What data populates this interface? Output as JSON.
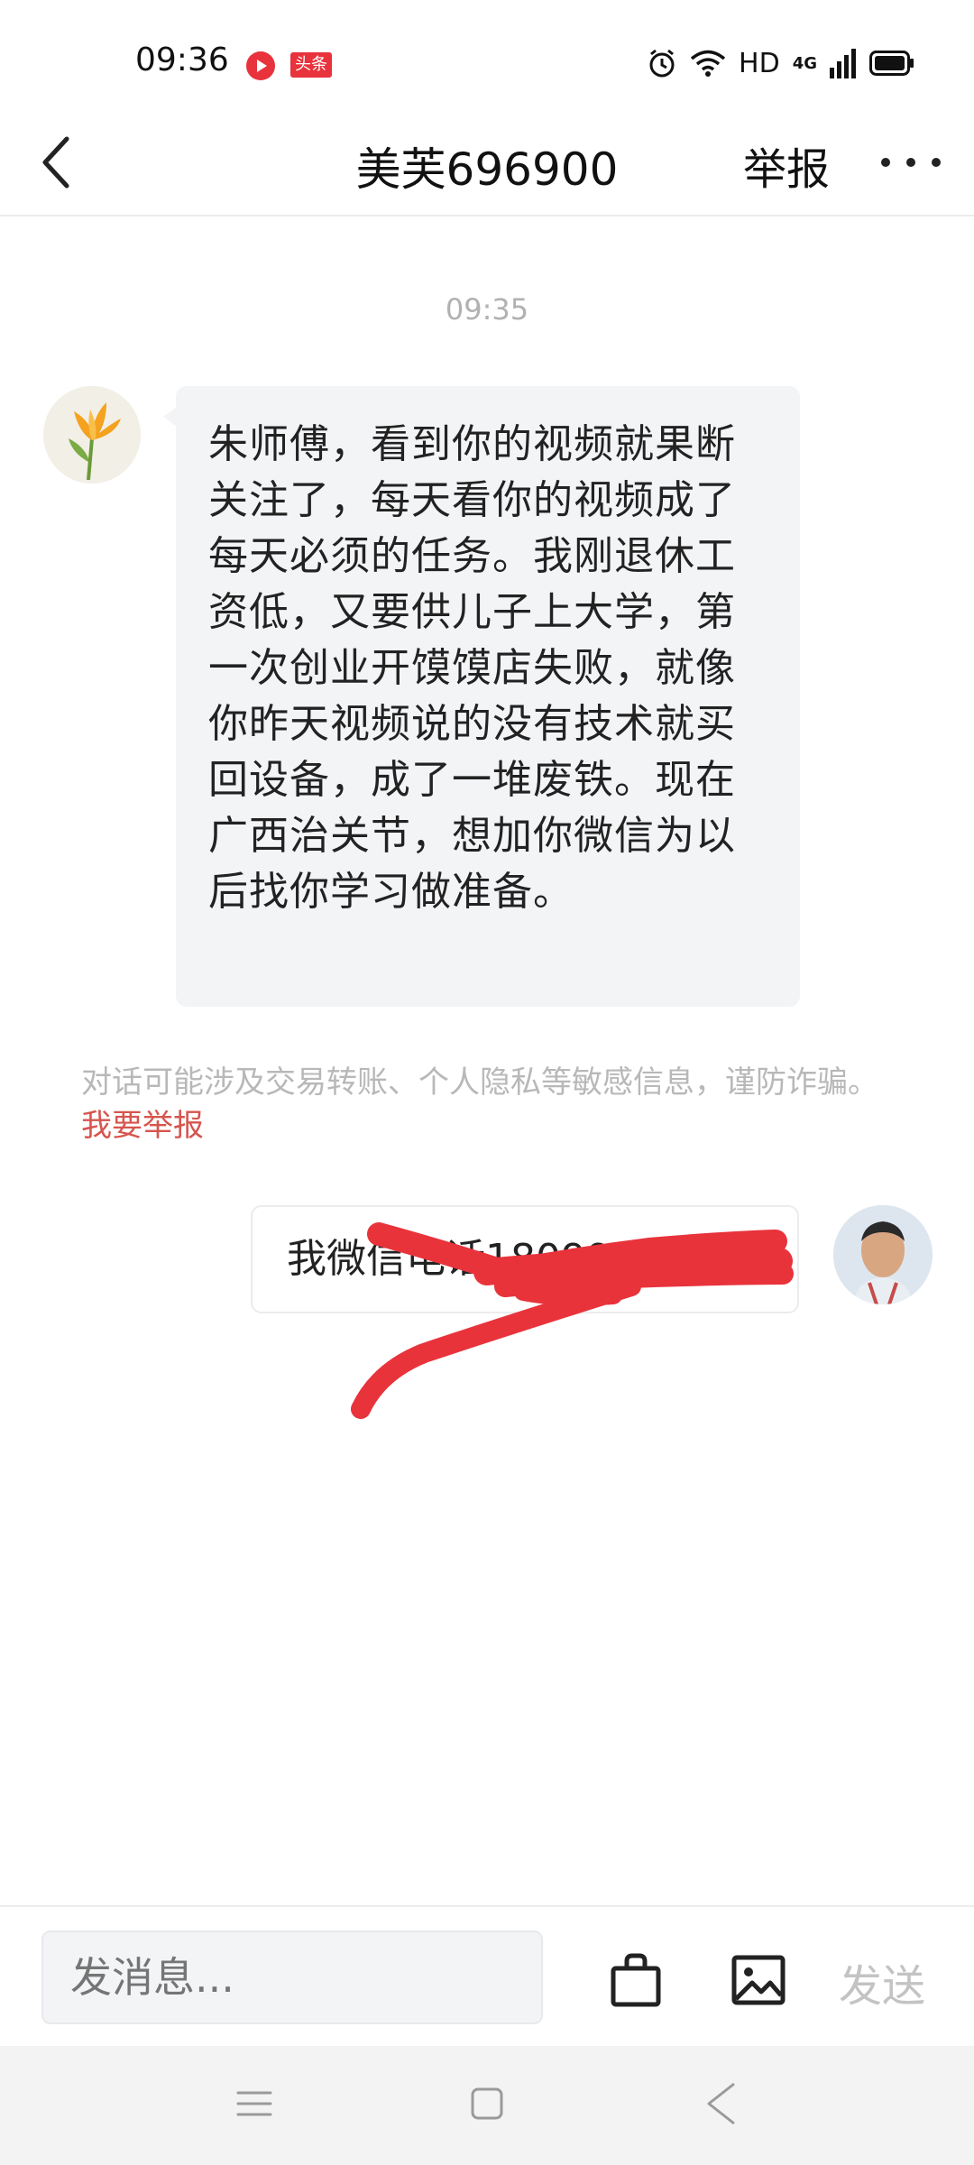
{
  "status_bar": {
    "time": "09:36",
    "app_badge": "头条",
    "network": "HD",
    "signal_type": "4G",
    "icons": [
      "video-app-icon",
      "toutiao-app-icon",
      "alarm-icon",
      "wifi-icon",
      "signal-icon",
      "battery-icon"
    ]
  },
  "header": {
    "title": "美芙696900",
    "report": "举报",
    "icons": [
      "back-arrow-icon",
      "more-dots-icon"
    ]
  },
  "chat": {
    "timestamp": "09:35",
    "received_message": "朱师傅，看到你的视频就果断关注了，每天看你的视频成了每天必须的任务。我刚退休工资低，又要供儿子上大学，第一次创业开馍馍店失败，就像你昨天视频说的没有技术就买回设备，成了一堆废铁。现在广西治关节，想加你微信为以后找你学习做准备。",
    "warning_text": "对话可能涉及交易转账、个人隐私等敏感信息，谨防诈骗。",
    "warning_link": "我要举报",
    "sent_message": "我微信电话1809999999",
    "sent_message_redacted": true
  },
  "input_bar": {
    "placeholder": "发消息...",
    "send": "发送",
    "icons": [
      "shopping-bag-icon",
      "image-icon"
    ]
  },
  "nav_bar": {
    "icons": [
      "menu-icon",
      "home-icon",
      "back-icon"
    ]
  },
  "colors": {
    "received_bubble": "#f3f4f6",
    "link_red": "#d6554e",
    "scribble_red": "#e8333b",
    "muted_text": "#b1b1b1"
  }
}
